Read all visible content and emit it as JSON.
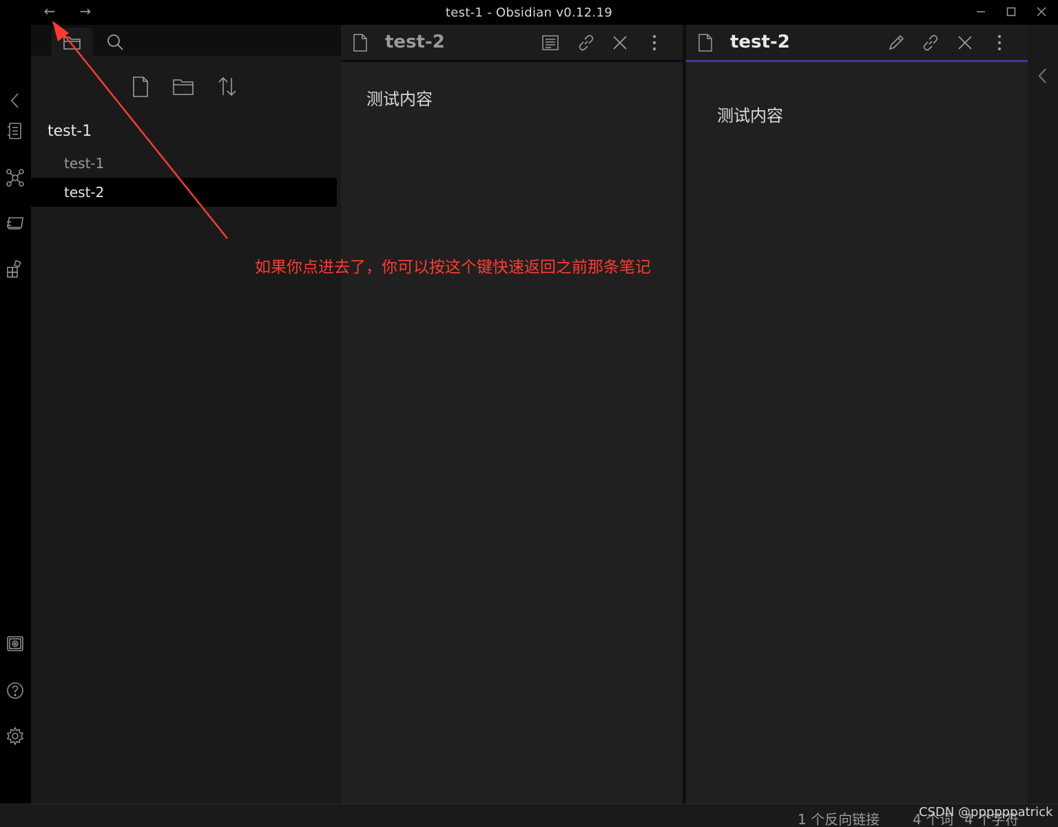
{
  "window": {
    "title": "test-1 - Obsidian v0.12.19",
    "back_glyph": "←",
    "forward_glyph": "→"
  },
  "ribbon": {
    "icons": [
      "switcher-icon",
      "graph-icon",
      "slides-icon",
      "plugins-icon",
      "vault-icon",
      "help-icon",
      "settings-icon"
    ]
  },
  "sidebar": {
    "tabs": [
      "folder-icon",
      "search-icon"
    ],
    "actions": [
      "new-note-icon",
      "new-folder-icon",
      "sort-icon"
    ],
    "folder": "test-1",
    "files": [
      {
        "label": "test-1",
        "active": false
      },
      {
        "label": "test-2",
        "active": true
      }
    ]
  },
  "panes": [
    {
      "title": "test-2",
      "content": "测试内容",
      "mode_icon": "reading-view-icon",
      "active": false
    },
    {
      "title": "test-2",
      "content": "测试内容",
      "mode_icon": "edit-icon",
      "active": true
    }
  ],
  "annotation": {
    "text": "如果你点进去了，你可以按这个键快速返回之前那条笔记",
    "color": "#ff3b30"
  },
  "statusbar": {
    "backlinks": "1 个反向链接",
    "words": "4 个词",
    "chars": "4 个字符"
  },
  "watermark": "CSDN @ppppppatrick",
  "colors": {
    "accent": "#483699",
    "background": "#202020"
  }
}
